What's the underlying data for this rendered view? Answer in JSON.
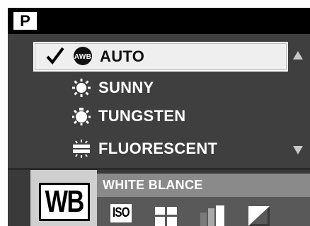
{
  "mode": {
    "label": "P"
  },
  "menu": {
    "items": [
      {
        "label": "AUTO",
        "icon": "awb-icon",
        "icon_text": "AWB",
        "selected": true,
        "checked": true
      },
      {
        "label": "SUNNY",
        "icon": "sun-icon",
        "selected": false
      },
      {
        "label": "TUNGSTEN",
        "icon": "tungsten-bulb-icon",
        "selected": false
      },
      {
        "label": "FLUORESCENT",
        "icon": "fluorescent-icon",
        "selected": false
      }
    ]
  },
  "scroll": {
    "up_icon": "triangle-up-icon",
    "down_icon": "triangle-down-icon"
  },
  "bottom_bar": {
    "current_tab": {
      "label": "WB",
      "icon": "wb-icon"
    },
    "title": "WHITE BLANCE",
    "tools": [
      {
        "icon": "iso-icon",
        "label": "ISO"
      },
      {
        "icon": "metering-icon"
      },
      {
        "icon": "contrast-bars-icon"
      },
      {
        "icon": "exposure-icon"
      }
    ]
  },
  "colors": {
    "background": "#3f3f3f",
    "header": "#000000",
    "selected_row": "#efefef",
    "title_bar": "#8a8a8a",
    "wb_cell": "#cfcfcf"
  }
}
